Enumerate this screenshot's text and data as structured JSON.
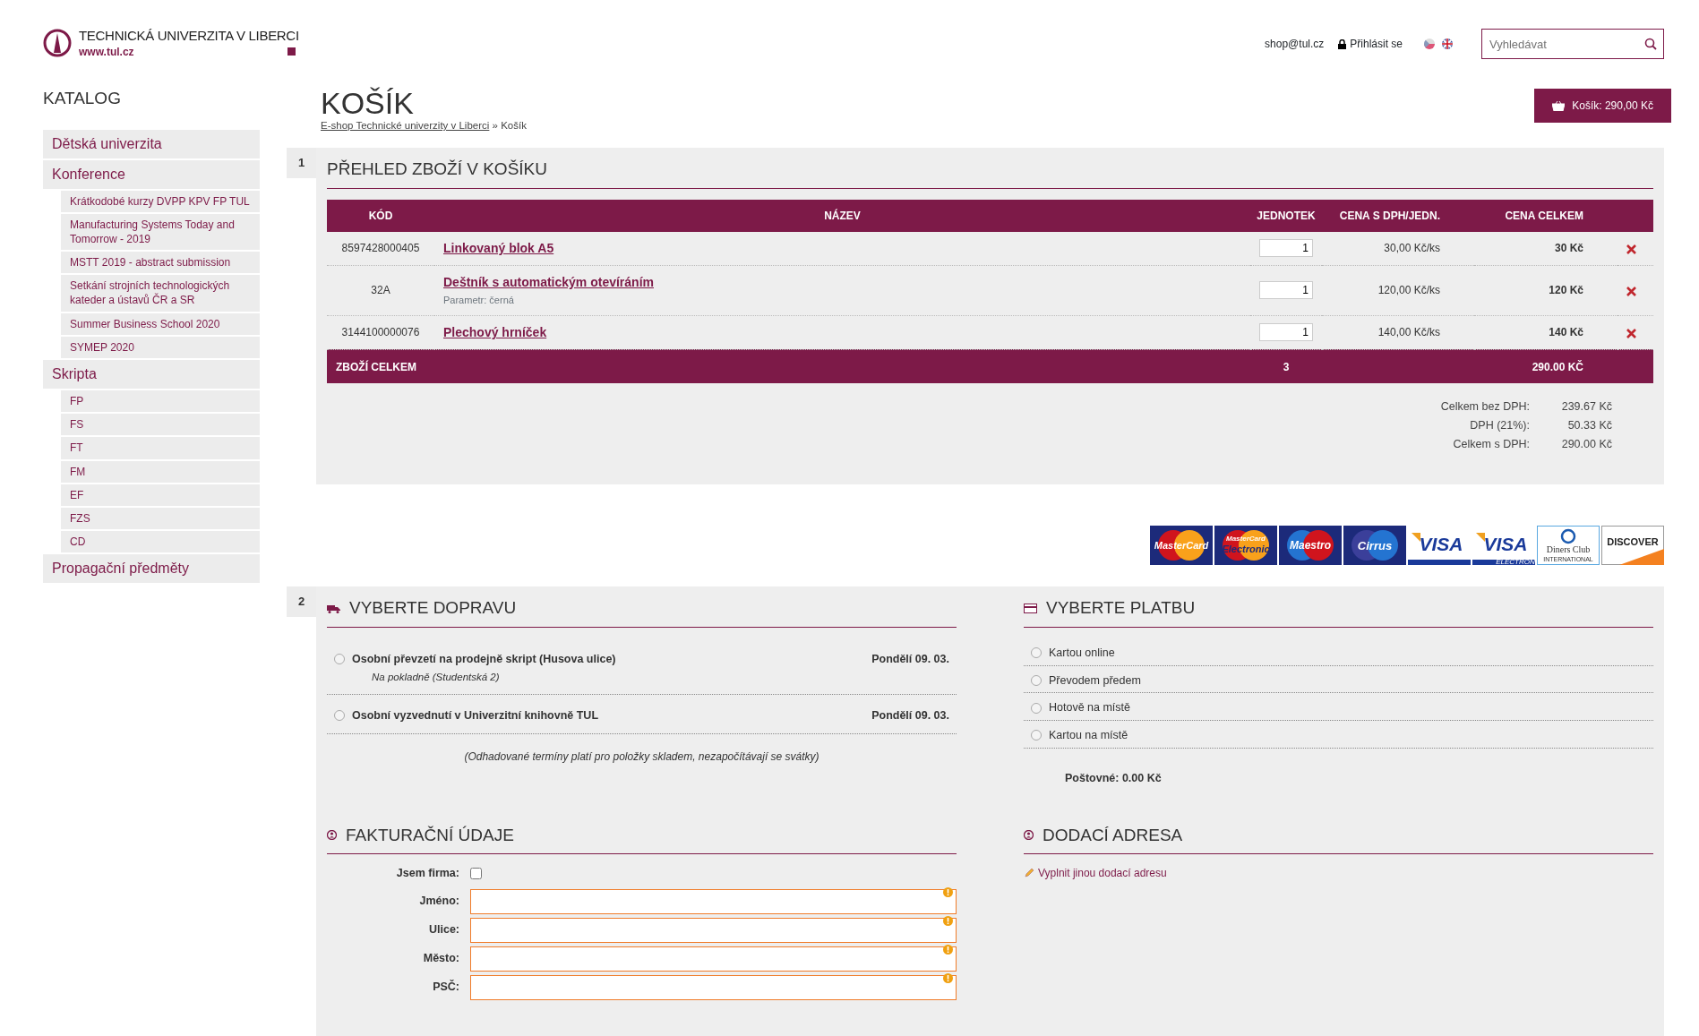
{
  "header": {
    "logo": {
      "name": "TECHNICKÁ UNIVERZITA V LIBERCI",
      "url": "www.tul.cz"
    },
    "email": "shop@tul.cz",
    "login": "Přihlásit se",
    "search": {
      "placeholder": "Vyhledávat"
    },
    "cart_button": "Košík: 290,00 Kč"
  },
  "sidebar": {
    "title": "KATALOG",
    "items": [
      {
        "label": "Dětská univerzita"
      },
      {
        "label": "Konference",
        "children": [
          {
            "label": "Krátkodobé kurzy DVPP KPV FP TUL"
          },
          {
            "label": "Manufacturing Systems Today and Tomorrow - 2019"
          },
          {
            "label": "MSTT 2019 - abstract submission"
          },
          {
            "label": "Setkání strojních technologických kateder a ústavů ČR a SR"
          },
          {
            "label": "Summer Business School 2020"
          },
          {
            "label": "SYMEP 2020"
          }
        ]
      },
      {
        "label": "Skripta",
        "children": [
          {
            "label": "FP"
          },
          {
            "label": "FS"
          },
          {
            "label": "FT"
          },
          {
            "label": "FM"
          },
          {
            "label": "EF"
          },
          {
            "label": "FZS"
          },
          {
            "label": "CD"
          }
        ]
      },
      {
        "label": "Propagační předměty"
      }
    ]
  },
  "page_title": "KOŠÍK",
  "breadcrumb": {
    "items": [
      "E-shop Technické univerzity v Liberci",
      "Košík"
    ],
    "separator": "»"
  },
  "cart": {
    "number": "1",
    "heading": "PŘEHLED ZBOŽÍ V KOŠÍKU",
    "columns": [
      "KÓD",
      "NÁZEV",
      "JEDNOTEK",
      "CENA S DPH/JEDN.",
      "CENA CELKEM"
    ],
    "rows": [
      {
        "code": "8597428000405",
        "name": "Linkovaný blok A5",
        "qty": "1",
        "unit_price": "30,00 Kč/ks",
        "total": "30 Kč"
      },
      {
        "code": "32A",
        "name": "Deštník s automatickým otevíráním",
        "param": "Parametr: černá",
        "qty": "1",
        "unit_price": "120,00 Kč/ks",
        "total": "120 Kč"
      },
      {
        "code": "3144100000076",
        "name": "Plechový hrníček",
        "qty": "1",
        "unit_price": "140,00 Kč/ks",
        "total": "140 Kč"
      }
    ],
    "total_row": {
      "label": "ZBOŽÍ CELKEM",
      "qty": "3",
      "total": "290.00 KČ"
    },
    "summary": [
      {
        "label": "Celkem bez DPH:",
        "value": "239.67 Kč"
      },
      {
        "label": "DPH (21%):",
        "value": "50.33 Kč"
      },
      {
        "label": "Celkem s DPH:",
        "value": "290.00 Kč"
      }
    ]
  },
  "cards": [
    {
      "kind": "mastercard",
      "texts": [
        "MasterCard"
      ]
    },
    {
      "kind": "mastercard",
      "texts": [
        "MasterCard",
        "Electronic"
      ]
    },
    {
      "kind": "maestro",
      "texts": [
        "Maestro"
      ]
    },
    {
      "kind": "cirrus",
      "texts": [
        "Cirrus"
      ]
    },
    {
      "kind": "visa",
      "texts": [
        "VISA"
      ]
    },
    {
      "kind": "visa",
      "texts": [
        "VISA",
        "ELECTRON"
      ]
    },
    {
      "kind": "diners",
      "texts": [
        "Diners Club",
        "INTERNATIONAL"
      ]
    },
    {
      "kind": "discover",
      "texts": [
        "DISCOVER"
      ]
    }
  ],
  "checkout": {
    "number": "2",
    "shipping": {
      "heading": "VYBERTE DOPRAVU",
      "options": [
        {
          "label": "Osobní převzetí na prodejně skript (Husova ulice)",
          "note": "Na pokladně (Studentská 2)",
          "date": "Pondělí 09. 03.",
          "selected": false
        },
        {
          "label": "Osobní vyzvednutí v Univerzitní knihovně TUL",
          "date": "Pondělí 09. 03.",
          "selected": false
        }
      ],
      "footnote": "(Odhadované termíny platí pro položky skladem, nezapočítávají se svátky)"
    },
    "payment": {
      "heading": "VYBERTE PLATBU",
      "options": [
        {
          "label": "Kartou online",
          "selected": false
        },
        {
          "label": "Převodem předem",
          "selected": false
        },
        {
          "label": "Hotově na místě",
          "selected": false
        },
        {
          "label": "Kartou na místě",
          "selected": false
        }
      ],
      "postage": "Poštovné: 0.00 Kč"
    },
    "billing": {
      "heading": "FAKTURAČNÍ ÚDAJE",
      "company": {
        "label": "Jsem firma:",
        "checked": false
      },
      "fields": [
        {
          "label": "Jméno:",
          "required": true
        },
        {
          "label": "Ulice:",
          "required": true
        },
        {
          "label": "Město:",
          "required": true
        },
        {
          "label": "PSČ:",
          "required": true
        }
      ]
    },
    "delivery": {
      "heading": "DODACÍ ADRESA",
      "link": "Vyplnit jinou dodací adresu"
    }
  }
}
